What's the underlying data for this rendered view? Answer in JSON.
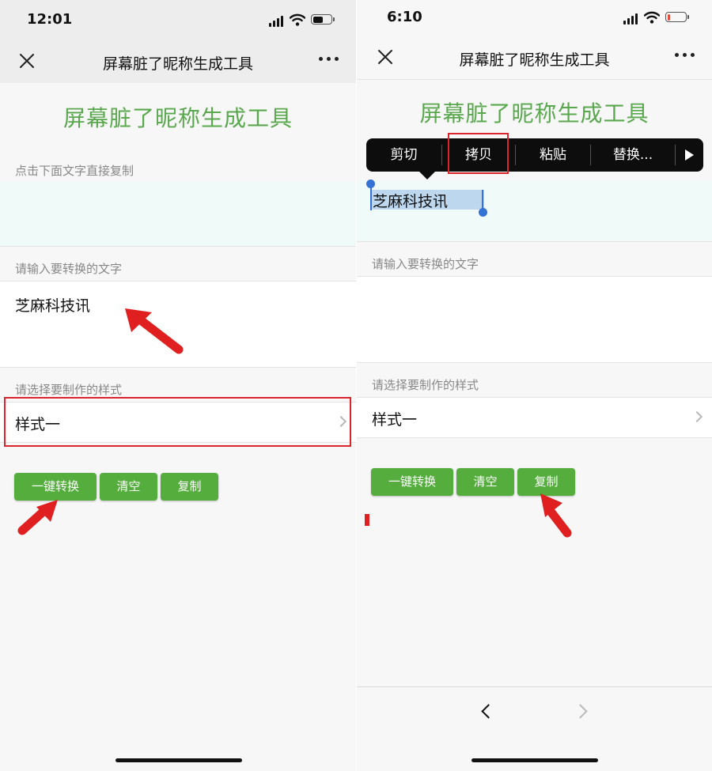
{
  "left_screen": {
    "status_bar": {
      "time": "12:01",
      "battery_level": 0.55
    },
    "nav": {
      "title": "屏幕脏了昵称生成工具"
    },
    "page_title": "屏幕脏了昵称生成工具",
    "output_label": "点击下面文字直接复制",
    "input_label": "请输入要转换的文字",
    "input_value": "芝麻科技讯",
    "style_label": "请选择要制作的样式",
    "style_selected": "样式一",
    "buttons": {
      "convert": "一键转换",
      "clear": "清空",
      "copy": "复制"
    }
  },
  "right_screen": {
    "status_bar": {
      "time": "6:10",
      "battery_level": 0.12
    },
    "nav": {
      "title": "屏幕脏了昵称生成工具"
    },
    "page_title": "屏幕脏了昵称生成工具",
    "context_menu": {
      "cut": "剪切",
      "copy": "拷贝",
      "paste": "粘贴",
      "replace": "替换...",
      "more_icon": "play-icon"
    },
    "output_value": "芝麻科技讯",
    "input_label": "请输入要转换的文字",
    "style_label": "请选择要制作的样式",
    "style_selected": "样式一",
    "buttons": {
      "convert": "一键转换",
      "clear": "清空",
      "copy": "复制"
    }
  },
  "colors": {
    "accent_green": "#55ad3e",
    "title_green": "#5aa84e",
    "highlight_red": "#d9252b",
    "selection_blue": "#bcd7ee",
    "handle_blue": "#3472d6",
    "battery_low_red": "#e54b3c"
  }
}
